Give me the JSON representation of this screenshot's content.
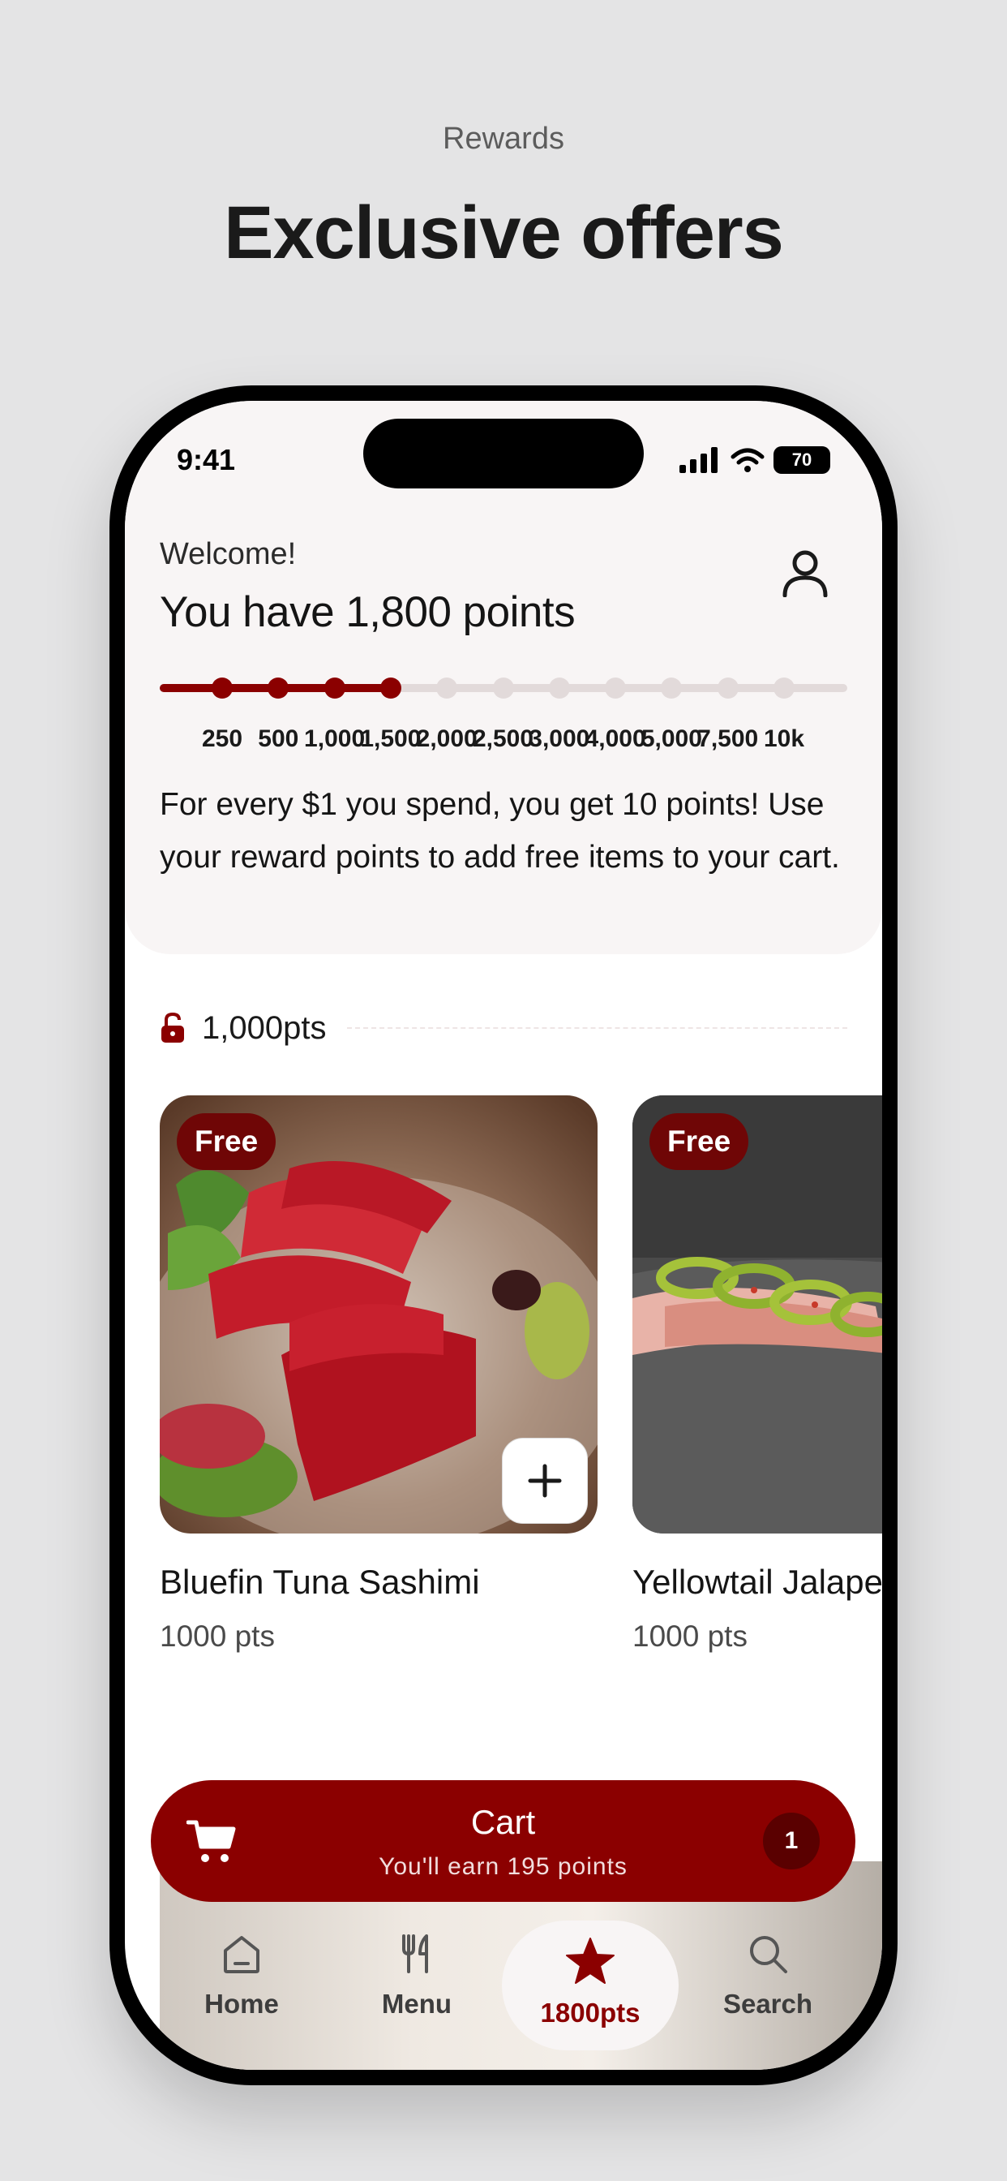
{
  "page": {
    "eyebrow": "Rewards",
    "title": "Exclusive offers"
  },
  "status_bar": {
    "time": "9:41",
    "battery": "70"
  },
  "header": {
    "welcome": "Welcome!",
    "points_heading": "You have 1,800 points",
    "progress_fraction": 0.33,
    "milestones": [
      {
        "label": "250",
        "reached": true
      },
      {
        "label": "500",
        "reached": true
      },
      {
        "label": "1,000",
        "reached": true
      },
      {
        "label": "1,500",
        "reached": true
      },
      {
        "label": "2,000",
        "reached": false
      },
      {
        "label": "2,500",
        "reached": false
      },
      {
        "label": "3,000",
        "reached": false
      },
      {
        "label": "4,000",
        "reached": false
      },
      {
        "label": "5,000",
        "reached": false
      },
      {
        "label": "7,500",
        "reached": false
      },
      {
        "label": "10k",
        "reached": false
      }
    ],
    "earn_text": "For every $1 you spend, you get 10 points! Use your reward points to add free items to your cart."
  },
  "tier": {
    "label": "1,000pts",
    "icon": "unlock-icon"
  },
  "items": [
    {
      "badge": "Free",
      "name": "Bluefin Tuna Sashimi",
      "pts": "1000 pts"
    },
    {
      "badge": "Free",
      "name": "Yellowtail Jalapeño",
      "pts": "1000 pts"
    }
  ],
  "cart": {
    "title": "Cart",
    "subtitle": "You'll earn 195 points",
    "count": "1"
  },
  "nav": [
    {
      "label": "Home",
      "icon": "home-icon"
    },
    {
      "label": "Menu",
      "icon": "utensils-icon"
    },
    {
      "label": "1800pts",
      "icon": "star-icon"
    },
    {
      "label": "Search",
      "icon": "search-icon"
    }
  ],
  "colors": {
    "accent": "#8b0000",
    "background": "#e4e4e5",
    "panel": "#f8f5f5"
  }
}
